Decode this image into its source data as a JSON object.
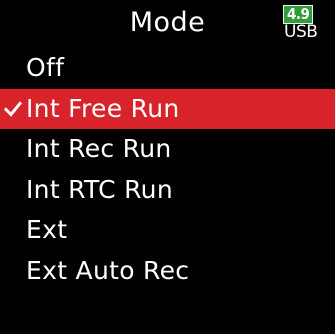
{
  "header": {
    "title": "Mode",
    "battery_level": "4.9",
    "power_source": "USB"
  },
  "menu": {
    "items": [
      {
        "label": "Off",
        "selected": false
      },
      {
        "label": "Int Free Run",
        "selected": true
      },
      {
        "label": "Int Rec Run",
        "selected": false
      },
      {
        "label": "Int RTC Run",
        "selected": false
      },
      {
        "label": "Ext",
        "selected": false
      },
      {
        "label": "Ext Auto Rec",
        "selected": false
      }
    ]
  },
  "colors": {
    "background": "#000000",
    "text": "#ffffff",
    "selection": "#d8232a",
    "battery": "#2f9e3a"
  },
  "icons": {
    "selected_marker": "checkmark-icon",
    "battery": "battery-icon"
  }
}
